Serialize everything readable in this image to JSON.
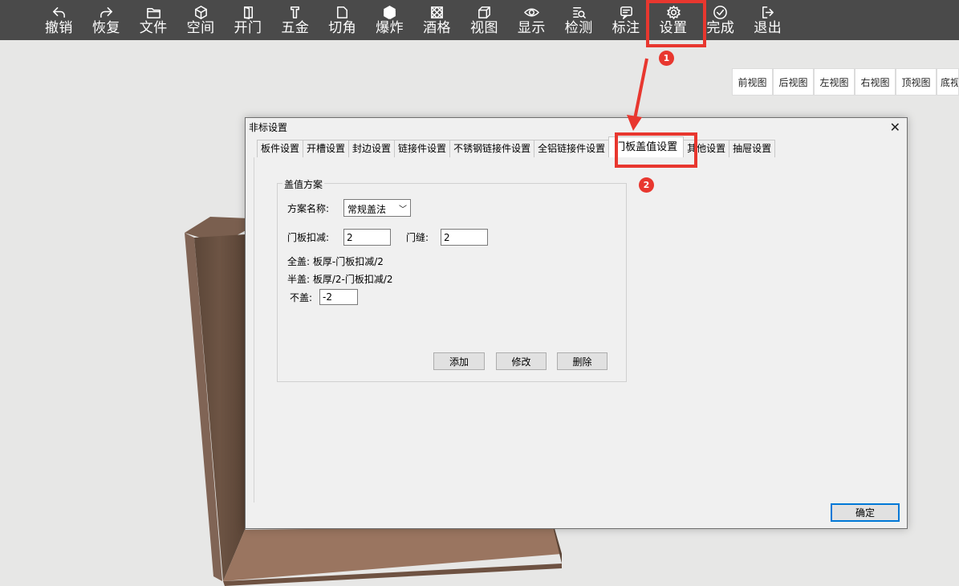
{
  "toolbar": {
    "items": [
      {
        "label": "撤销",
        "icon": "undo-icon"
      },
      {
        "label": "恢复",
        "icon": "redo-icon"
      },
      {
        "label": "文件",
        "icon": "folder-icon"
      },
      {
        "label": "空间",
        "icon": "cube-icon"
      },
      {
        "label": "开门",
        "icon": "door-icon"
      },
      {
        "label": "五金",
        "icon": "hardware-icon"
      },
      {
        "label": "切角",
        "icon": "corner-cut-icon"
      },
      {
        "label": "爆炸",
        "icon": "explode-icon"
      },
      {
        "label": "酒格",
        "icon": "wine-rack-icon"
      },
      {
        "label": "视图",
        "icon": "view-cube-icon"
      },
      {
        "label": "显示",
        "icon": "eye-icon"
      },
      {
        "label": "检测",
        "icon": "inspect-icon"
      },
      {
        "label": "标注",
        "icon": "annotate-icon"
      },
      {
        "label": "设置",
        "icon": "gear-icon"
      },
      {
        "label": "完成",
        "icon": "check-circle-icon"
      },
      {
        "label": "退出",
        "icon": "exit-icon"
      }
    ]
  },
  "views": [
    "前视图",
    "后视图",
    "左视图",
    "右视图",
    "顶视图",
    "底视图"
  ],
  "dialog": {
    "title": "非标设置",
    "close": "✕",
    "tabs": [
      "板件设置",
      "开槽设置",
      "封边设置",
      "链接件设置",
      "不锈钢链接件设置",
      "全铝链接件设置",
      "门板盖值设置",
      "其他设置",
      "抽屉设置"
    ],
    "active_tab": "门板盖值设置",
    "group_title": "盖值方案",
    "scheme_label": "方案名称:",
    "scheme_value": "常规盖法",
    "door_deduct_label": "门板扣减:",
    "door_deduct_value": "2",
    "door_gap_label": "门缝:",
    "door_gap_value": "2",
    "full_cover": "全盖: 板厚-门板扣减/2",
    "half_cover": "半盖: 板厚/2-门板扣减/2",
    "no_cover_label": "不盖:",
    "no_cover_value": "-2",
    "add_btn": "添加",
    "edit_btn": "修改",
    "delete_btn": "删除",
    "ok_btn": "确定"
  },
  "annotations": {
    "badge1": "1",
    "badge2": "2",
    "color": "#e8372f"
  }
}
